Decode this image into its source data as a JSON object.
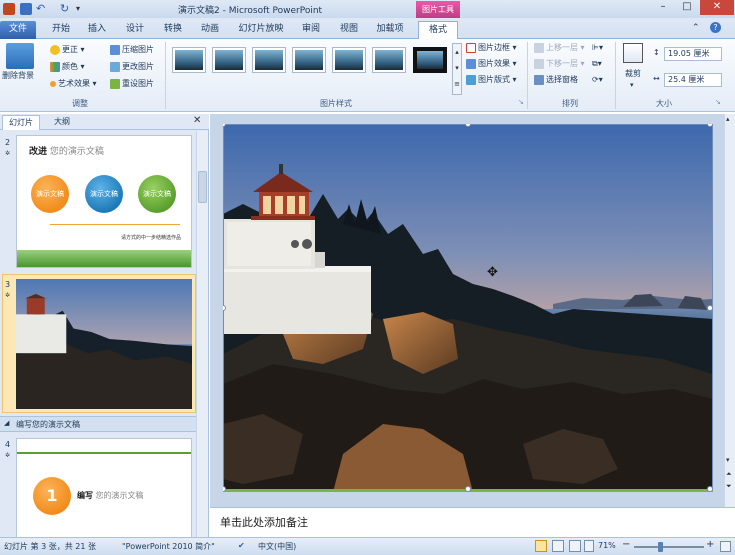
{
  "window": {
    "title": "演示文稿2 - Microsoft PowerPoint",
    "contextual_group": "图片工具",
    "minimize": "–",
    "maximize": "□",
    "close": "✕"
  },
  "tabs": [
    "文件",
    "开始",
    "插入",
    "设计",
    "转换",
    "动画",
    "幻灯片放映",
    "审阅",
    "视图",
    "加载项",
    "格式"
  ],
  "ribbon": {
    "adjust": {
      "remove_background": "删除背景",
      "corrections": "更正",
      "color": "颜色",
      "artistic_effects": "艺术效果",
      "compress": "压缩图片",
      "change_picture": "更改图片",
      "reset_picture": "重设图片",
      "label": "调整"
    },
    "picture_styles": {
      "border": "图片边框",
      "effects": "图片效果",
      "layout": "图片版式",
      "label": "图片样式"
    },
    "arrange": {
      "bring_forward": "上移一层",
      "send_backward": "下移一层",
      "selection_pane": "选择窗格",
      "label": "排列"
    },
    "size": {
      "crop": "裁剪",
      "height": "19.05 厘米",
      "width": "25.4 厘米",
      "label": "大小"
    }
  },
  "left_panel": {
    "tab_slides": "幻灯片",
    "tab_outline": "大纲",
    "close": "✕",
    "slide2": {
      "num": "2",
      "title_bold": "改进",
      "title_rest": " 您的演示文稿",
      "circle1": "演示文稿",
      "circle2": "演示文稿",
      "circle3": "演示文稿",
      "footer": "请方式的中一步结精选作品"
    },
    "slide3": {
      "num": "3"
    },
    "section_header": "编写您的演示文稿",
    "slide4": {
      "num": "4",
      "circle_num": "1",
      "title_bold": "编写",
      "title_rest": " 您的演示文稿"
    }
  },
  "notes": {
    "placeholder": "单击此处添加备注"
  },
  "statusbar": {
    "slide_info": "幻灯片 第 3 张，共 21 张",
    "theme": "\"PowerPoint 2010 简介\"",
    "language": "中文(中国)",
    "zoom": "71%"
  },
  "colors": {
    "accent_blue": "#2e5fae",
    "contextual_pink": "#c23a86",
    "orange": "#f28c1b",
    "teal": "#1d7ab8",
    "green": "#5aa02c"
  }
}
